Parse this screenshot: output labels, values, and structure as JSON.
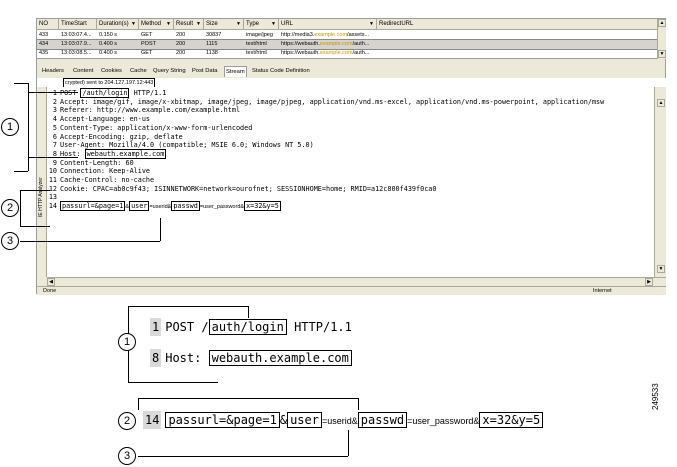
{
  "session_grid": {
    "columns": [
      "NO",
      "TimeStart",
      "Duration(s)",
      "Method",
      "Result",
      "Size",
      "Type",
      "URL",
      "RedirectURL"
    ],
    "rows": [
      {
        "no": "433",
        "time": "13:03:07.4...",
        "duration": "0.150 s",
        "method": "GET",
        "result": "200",
        "size": "30837",
        "type": "image/jpeg",
        "url_pre": "http://media3.",
        "url_hl": "example.com",
        "url_post": "/assets...",
        "selected": false
      },
      {
        "no": "434",
        "time": "13:03:07.9...",
        "duration": "0.400 s",
        "method": "POST",
        "result": "200",
        "size": "1115",
        "type": "text/html",
        "url_pre": "https://webauth.",
        "url_hl": "example.com",
        "url_post": "/auth...",
        "selected": true
      },
      {
        "no": "435",
        "time": "13:03:08.5...",
        "duration": "0.400 s",
        "method": "GET",
        "result": "200",
        "size": "1138",
        "type": "text/html",
        "url_pre": "https://webauth.",
        "url_hl": "example.com",
        "url_post": "/auth...",
        "selected": false
      }
    ]
  },
  "tabs": [
    "Headers",
    "Content",
    "Cookies",
    "Cache",
    "Query String",
    "Post Data",
    "Stream",
    "Status Code Definition"
  ],
  "active_tab": "Stream",
  "status_line": {
    "pre": "crypted) sent to 204.127.197.12:443"
  },
  "request_lines": [
    {
      "n": "1",
      "pre": "POST ",
      "box": "/auth/login",
      "post": " HTTP/1.1"
    },
    {
      "n": "2",
      "pre": "Accept: image/gif, image/x-xbitmap, image/jpeg, image/pjpeg, application/vnd.ms-excel, application/vnd.ms-powerpoint, application/msw"
    },
    {
      "n": "3",
      "pre": "Referer: http://www.example.com/example.html"
    },
    {
      "n": "4",
      "pre": "Accept-Language: en-us"
    },
    {
      "n": "5",
      "pre": "Content-Type: application/x-www-form-urlencoded"
    },
    {
      "n": "6",
      "pre": "Accept-Encoding: gzip, deflate"
    },
    {
      "n": "7",
      "pre": "User-Agent: Mozilla/4.0 (compatible; MSIE 6.0; Windows NT 5.0)"
    },
    {
      "n": "8",
      "pre": "Host: ",
      "box": "webauth.example.com"
    },
    {
      "n": "9",
      "pre": "Content-Length: 60"
    },
    {
      "n": "10",
      "pre": "Connection: Keep-Alive"
    },
    {
      "n": "11",
      "pre": "Cache-Control: no-cache"
    },
    {
      "n": "12",
      "pre": "Cookie: CPAC=ab0c9f43; ISINNETWORK=network=ourofnet; SESSIONHOME=home; RMID=a12c800f439f0ca0"
    },
    {
      "n": "13",
      "pre": ""
    },
    {
      "n": "14",
      "pre": ""
    }
  ],
  "line14": {
    "box1": "passurl=&page=1",
    "amp1": "&",
    "box2": "user",
    "mid1": "=userid&",
    "box3": "passwd",
    "mid2": "=user_password&",
    "box4": "x=32&y=5"
  },
  "sidebar_label": "IE HTTP Analyzer",
  "window_status": {
    "done": "Done",
    "zone": "Internet"
  },
  "zoom": {
    "line1": {
      "n": "1",
      "pre": "POST /",
      "box": "auth/login",
      "post": " HTTP/1.1"
    },
    "line8": {
      "n": "8",
      "pre": "Host: ",
      "box": "webauth.example.com"
    },
    "line14": {
      "n": "14",
      "box1": "passurl=&page=1",
      "amp1": "&",
      "box2": "user",
      "mid1": "=userid&",
      "box3": "passwd",
      "mid2": "=user_password&",
      "box4": "x=32&y=5"
    }
  },
  "callouts": [
    "1",
    "2",
    "3"
  ],
  "figure_id": "249533"
}
